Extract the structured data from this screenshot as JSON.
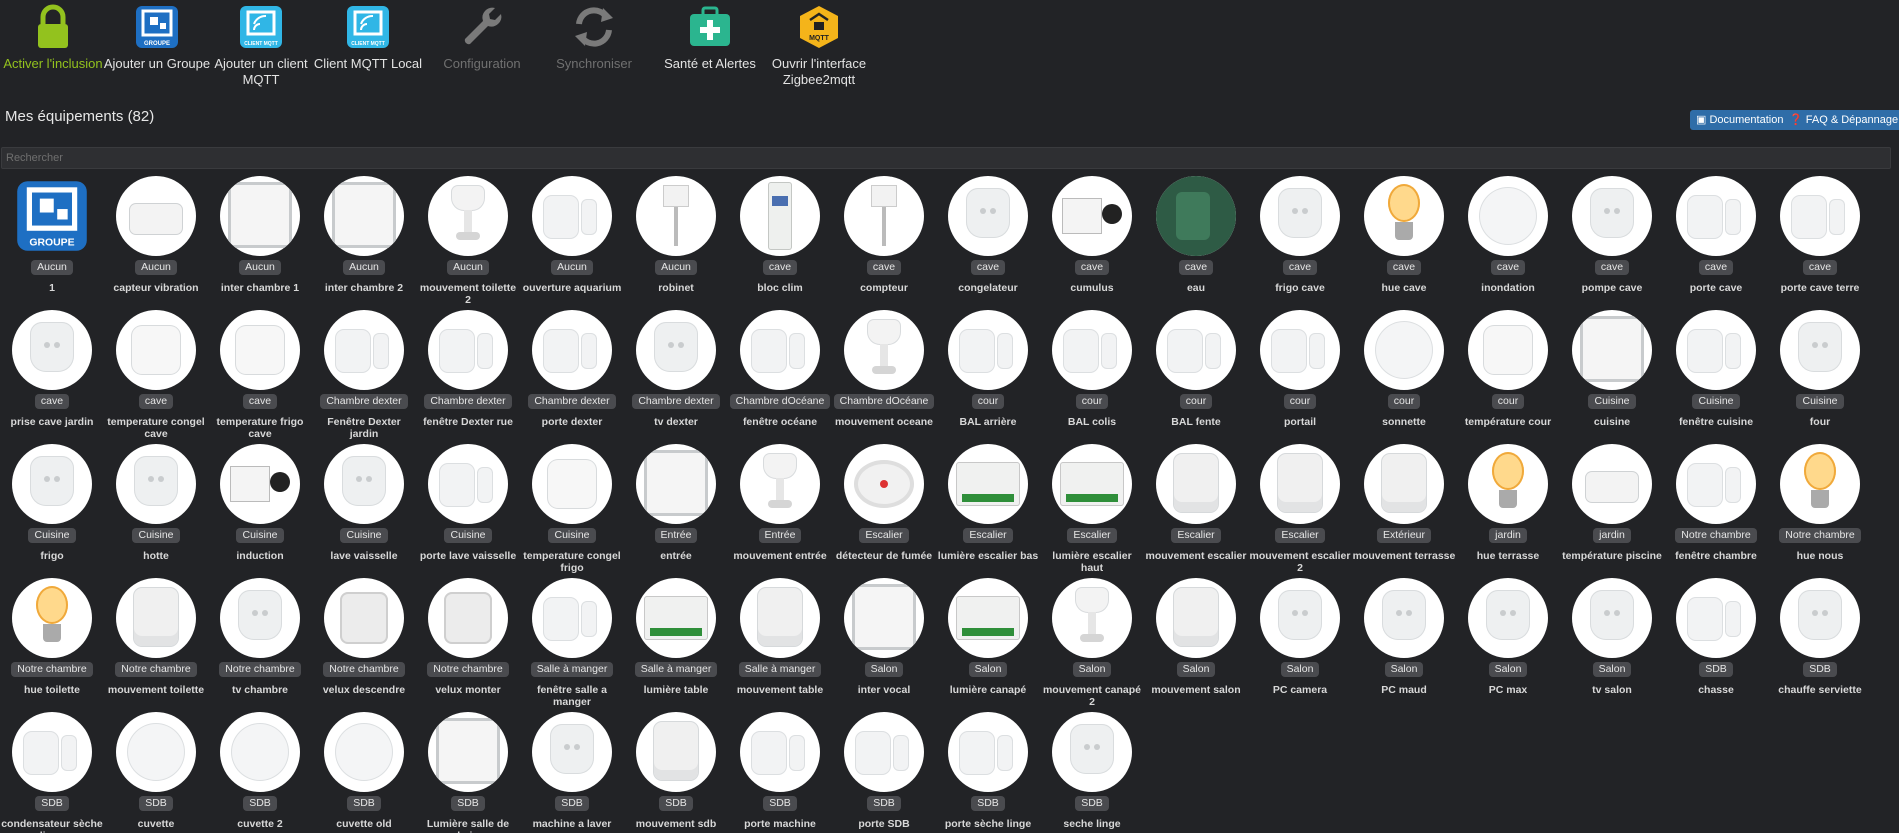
{
  "toolbar": {
    "buttons": [
      {
        "label": "Activer l'inclusion",
        "icon": "lock-icon",
        "style": "green",
        "color": "#93c21e"
      },
      {
        "label": "Ajouter un Groupe",
        "icon": "groupe-icon",
        "style": "",
        "color": "#1e6fc3"
      },
      {
        "label": "Ajouter un client MQTT",
        "icon": "client-mqtt-icon",
        "style": "",
        "color": "#30b6e6"
      },
      {
        "label": "Client MQTT Local",
        "icon": "client-mqtt-local-icon",
        "style": "",
        "color": "#30b6e6"
      },
      {
        "label": "Configuration",
        "icon": "wrench-icon",
        "style": "grey",
        "color": "#7a7a7a"
      },
      {
        "label": "Synchroniser",
        "icon": "sync-icon",
        "style": "grey",
        "color": "#7a7a7a"
      },
      {
        "label": "Santé et Alertes",
        "icon": "health-kit-icon",
        "style": "",
        "color": "#2bb58f"
      },
      {
        "label": "Ouvrir l'interface Zigbee2mqtt",
        "icon": "zigbee2mqtt-icon",
        "style": "",
        "color": "#f4b41a"
      }
    ],
    "groupe_text": "GROUPE",
    "client_text": "CLIENT MQTT",
    "mqtt_text": "MQTT"
  },
  "section": {
    "title": "Mes équipements (82)",
    "doc_button": "Documentation",
    "faq_button": "FAQ & Dépannage"
  },
  "search": {
    "placeholder": "Rechercher",
    "value": ""
  },
  "devices": [
    [
      {
        "room": "Aucun",
        "name": "1",
        "type": "groupe"
      },
      {
        "room": "Aucun",
        "name": "capteur vibration",
        "type": "pad"
      },
      {
        "room": "Aucun",
        "name": "inter chambre 1",
        "type": "switch"
      },
      {
        "room": "Aucun",
        "name": "inter chambre 2",
        "type": "switch"
      },
      {
        "room": "Aucun",
        "name": "mouvement toilette 2",
        "type": "motion"
      },
      {
        "room": "Aucun",
        "name": "ouverture aquarium",
        "type": "door"
      },
      {
        "room": "Aucun",
        "name": "robinet",
        "type": "wire"
      },
      {
        "room": "cave",
        "name": "bloc clim",
        "type": "meter"
      },
      {
        "room": "cave",
        "name": "compteur",
        "type": "wire"
      },
      {
        "room": "cave",
        "name": "congelateur",
        "type": "plug"
      },
      {
        "room": "cave",
        "name": "cumulus",
        "type": "clamp"
      },
      {
        "room": "cave",
        "name": "eau",
        "type": "valve"
      },
      {
        "room": "cave",
        "name": "frigo cave",
        "type": "plug"
      },
      {
        "room": "cave",
        "name": "hue cave",
        "type": "bulb"
      },
      {
        "room": "cave",
        "name": "inondation",
        "type": "round"
      },
      {
        "room": "cave",
        "name": "pompe cave",
        "type": "plug"
      },
      {
        "room": "cave",
        "name": "porte cave",
        "type": "door"
      },
      {
        "room": "cave",
        "name": "porte cave terre",
        "type": "door"
      }
    ],
    [
      {
        "room": "cave",
        "name": "prise cave jardin",
        "type": "plug"
      },
      {
        "room": "cave",
        "name": "temperature congel cave",
        "type": "square"
      },
      {
        "room": "cave",
        "name": "temperature frigo cave",
        "type": "square"
      },
      {
        "room": "Chambre dexter",
        "name": "Fenêtre Dexter jardin",
        "type": "door"
      },
      {
        "room": "Chambre dexter",
        "name": "fenêtre Dexter rue",
        "type": "door"
      },
      {
        "room": "Chambre dexter",
        "name": "porte dexter",
        "type": "door"
      },
      {
        "room": "Chambre dexter",
        "name": "tv dexter",
        "type": "plug"
      },
      {
        "room": "Chambre dOcéane",
        "name": "fenêtre océane",
        "type": "door"
      },
      {
        "room": "Chambre dOcéane",
        "name": "mouvement oceane",
        "type": "motion"
      },
      {
        "room": "cour",
        "name": "BAL arrière",
        "type": "door"
      },
      {
        "room": "cour",
        "name": "BAL colis",
        "type": "door"
      },
      {
        "room": "cour",
        "name": "BAL fente",
        "type": "door"
      },
      {
        "room": "cour",
        "name": "portail",
        "type": "door"
      },
      {
        "room": "cour",
        "name": "sonnette",
        "type": "round"
      },
      {
        "room": "cour",
        "name": "température cour",
        "type": "square"
      },
      {
        "room": "Cuisine",
        "name": "cuisine",
        "type": "switch"
      },
      {
        "room": "Cuisine",
        "name": "fenêtre cuisine",
        "type": "door"
      },
      {
        "room": "Cuisine",
        "name": "four",
        "type": "plug"
      }
    ],
    [
      {
        "room": "Cuisine",
        "name": "frigo",
        "type": "plug"
      },
      {
        "room": "Cuisine",
        "name": "hotte",
        "type": "plug"
      },
      {
        "room": "Cuisine",
        "name": "induction",
        "type": "clamp"
      },
      {
        "room": "Cuisine",
        "name": "lave vaisselle",
        "type": "plug"
      },
      {
        "room": "Cuisine",
        "name": "porte lave vaisselle",
        "type": "door"
      },
      {
        "room": "Cuisine",
        "name": "temperature congel frigo",
        "type": "square"
      },
      {
        "room": "Entrée",
        "name": "entrée",
        "type": "switch"
      },
      {
        "room": "Entrée",
        "name": "mouvement entrée",
        "type": "motion"
      },
      {
        "room": "Escalier",
        "name": "détecteur de fumée",
        "type": "smoke"
      },
      {
        "room": "Escalier",
        "name": "lumière escalier bas",
        "type": "module"
      },
      {
        "room": "Escalier",
        "name": "lumière escalier haut",
        "type": "module"
      },
      {
        "room": "Escalier",
        "name": "mouvement escalier",
        "type": "cyl"
      },
      {
        "room": "Escalier",
        "name": "mouvement escalier 2",
        "type": "cyl"
      },
      {
        "room": "Extérieur",
        "name": "mouvement terrasse",
        "type": "cyl"
      },
      {
        "room": "jardin",
        "name": "hue terrasse",
        "type": "bulb"
      },
      {
        "room": "jardin",
        "name": "température piscine",
        "type": "pad"
      },
      {
        "room": "Notre chambre",
        "name": "fenêtre chambre",
        "type": "door"
      },
      {
        "room": "Notre chambre",
        "name": "hue nous",
        "type": "bulb"
      }
    ],
    [
      {
        "room": "Notre chambre",
        "name": "hue toilette",
        "type": "bulb"
      },
      {
        "room": "Notre chambre",
        "name": "mouvement toilette",
        "type": "cyl"
      },
      {
        "room": "Notre chambre",
        "name": "tv chambre",
        "type": "plug"
      },
      {
        "room": "Notre chambre",
        "name": "velux descendre",
        "type": "cube"
      },
      {
        "room": "Notre chambre",
        "name": "velux monter",
        "type": "cube"
      },
      {
        "room": "Salle à manger",
        "name": "fenêtre salle a manger",
        "type": "door"
      },
      {
        "room": "Salle à manger",
        "name": "lumière table",
        "type": "module"
      },
      {
        "room": "Salle à manger",
        "name": "mouvement table",
        "type": "cyl"
      },
      {
        "room": "Salon",
        "name": "inter vocal",
        "type": "switch"
      },
      {
        "room": "Salon",
        "name": "lumière canapé",
        "type": "module"
      },
      {
        "room": "Salon",
        "name": "mouvement canapé 2",
        "type": "motion"
      },
      {
        "room": "Salon",
        "name": "mouvement salon",
        "type": "cyl"
      },
      {
        "room": "Salon",
        "name": "PC camera",
        "type": "plug"
      },
      {
        "room": "Salon",
        "name": "PC maud",
        "type": "plug"
      },
      {
        "room": "Salon",
        "name": "PC max",
        "type": "plug"
      },
      {
        "room": "Salon",
        "name": "tv salon",
        "type": "plug"
      },
      {
        "room": "SDB",
        "name": "chasse",
        "type": "door"
      },
      {
        "room": "SDB",
        "name": "chauffe serviette",
        "type": "plug"
      }
    ],
    [
      {
        "room": "SDB",
        "name": "condensateur sèche linge",
        "type": "door"
      },
      {
        "room": "SDB",
        "name": "cuvette",
        "type": "round"
      },
      {
        "room": "SDB",
        "name": "cuvette 2",
        "type": "round"
      },
      {
        "room": "SDB",
        "name": "cuvette old",
        "type": "round"
      },
      {
        "room": "SDB",
        "name": "Lumière salle de bain",
        "type": "switch"
      },
      {
        "room": "SDB",
        "name": "machine a laver",
        "type": "plug"
      },
      {
        "room": "SDB",
        "name": "mouvement sdb",
        "type": "cyl"
      },
      {
        "room": "SDB",
        "name": "porte machine",
        "type": "door"
      },
      {
        "room": "SDB",
        "name": "porte SDB",
        "type": "door"
      },
      {
        "room": "SDB",
        "name": "porte sèche linge",
        "type": "door"
      },
      {
        "room": "SDB",
        "name": "seche linge",
        "type": "plug"
      }
    ]
  ]
}
